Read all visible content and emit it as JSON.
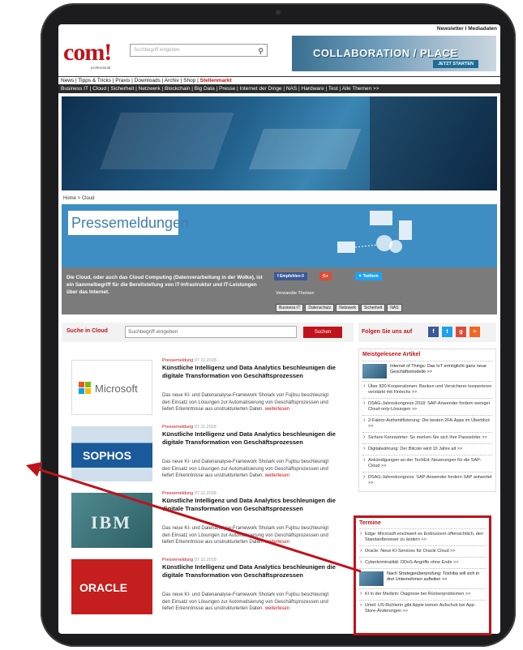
{
  "topbar": {
    "newsletter": "Newsletter",
    "separator": "I",
    "mediadaten": "Mediadaten"
  },
  "logo": {
    "text": "com!",
    "sub": "professional"
  },
  "header_search": {
    "placeholder": "Suchbegriff eingeben"
  },
  "banner": {
    "title": "COLLABORATION / PLACE",
    "button": "JETZT STARTEN"
  },
  "nav_primary": {
    "items": "News | Tipps & Tricks | Praxis | Downloads | Archiv | Shop |",
    "highlight": "Stellenmarkt"
  },
  "nav_secondary": "Business IT | Cloud | Sicherheit | Netzwerk | Blockchain | Big Data | Presse | Internet der Dinge | NAS | Hardware | Test | Alle Themen >>",
  "breadcrumb": "Home > Cloud",
  "press": {
    "title": "Pressemeldungen",
    "description": "Die Cloud, oder auch das Cloud Computing (Datenverarbeitung in der Wolke), ist ein Sammelbegriff für die Bereitstellung von IT-Infrastruktur und IT-Leistungen über das Internet.",
    "share_facebook": "Empfehlen 0",
    "share_gplus": "G+",
    "share_twitter": "Twittern",
    "related_label": "Verwandte Themen",
    "tags": [
      "Business-IT",
      "Datenschutz",
      "Netzwerk",
      "Sicherheit",
      "NAS"
    ]
  },
  "cloud_search": {
    "label": "Suche in Cloud",
    "placeholder": "Suchbegriff eingeben",
    "button": "Suchen"
  },
  "articles": [
    {
      "logo": "Microsoft",
      "category": "Pressemeldung",
      "date": "07.11.2018",
      "title": "Künstliche Intelligenz und Data Analytics beschleunigen die digitale Transformation von Geschäftsprozessen",
      "text": "Das neue KI- und Datenanalyse-Framework Sholark von Fujitsu beschleunigt den Einsatz von Lösungen zur Automatisierung von Geschäftsprozessen und liefert Erkenntnisse aus unstrukturierten Daten.",
      "more": "weiterlesen"
    },
    {
      "logo": "SOPHOS",
      "category": "Pressemeldung",
      "date": "07.11.2018",
      "title": "Künstliche Intelligenz und Data Analytics beschleunigen die digitale Transformation von Geschäftsprozessen",
      "text": "Das neue KI- und Datenanalyse-Framework Sholark von Fujitsu beschleunigt den Einsatz von Lösungen zur Automatisierung von Geschäftsprozessen und liefert Erkenntnisse aus unstrukturierten Daten.",
      "more": "weiterlesen"
    },
    {
      "logo": "IBM",
      "category": "Pressemeldung",
      "date": "07.11.2018",
      "title": "Künstliche Intelligenz und Data Analytics beschleunigen die digitale Transformation von Geschäftsprozessen",
      "text": "Das neue KI- und Datenanalyse-Framework Sholark von Fujitsu beschleunigt den Einsatz von Lösungen zur Automatisierung von Geschäftsprozessen und liefert Erkenntnisse aus unstrukturierten Daten.",
      "more": "weiterlesen"
    },
    {
      "logo": "ORACLE",
      "category": "Pressemeldung",
      "date": "07.11.2018",
      "title": "Künstliche Intelligenz und Data Analytics beschleunigen die digitale Transformation von Geschäftsprozessen",
      "text": "Das neue KI- und Datenanalyse-Framework Sholark von Fujitsu beschleunigt den Einsatz von Lösungen zur Automatisierung von Geschäftsprozessen und liefert Erkenntnisse aus unstrukturierten Daten.",
      "more": "weiterlesen"
    }
  ],
  "follow": {
    "label": "Folgen Sie uns auf"
  },
  "most_read": {
    "title": "Meistgelesene Artikel",
    "featured": "Internet of Things: Das IoT ermöglicht ganz neue Geschäftsmodelle >>",
    "items": [
      "Über 830 Kooperationen: Banken und Versicherer kooperieren verstärkt mit Fintechs >>",
      "DSAG-Jahreskongress 2018: SAP-Anwender fordern weniger Cloud-only-Lösungen >>",
      "2-Faktor-Authentifizierung: Die besten 2FA-Apps im Überblick >>",
      "Sichere Kennwörter: So merken Sie sich Ihre Passwörter >>",
      "Digitalwährung: Der Bitcoin wird 10 Jahre alt >>",
      "Ankündigungen an der TechEd: Neuerungen für die SAP-Cloud >>",
      "DSAG-Jahreskongress: SAP-Anwender fordern SAP antwortet >>"
    ]
  },
  "termine": {
    "title": "Termine",
    "items": [
      "Edge: Microsoft erschwert es Endnutzern offensichtlich, den Standardbrowser zu ändern >>",
      "Oracle: Neue KI-Services für Oracle Cloud >>",
      "Cyberkriminalität: DDoS-Angriffe ohne Ende >>"
    ],
    "featured": "Nach Strategieüberprüfung: Toshiba will sich in drei Unternehmen aufteilen >>",
    "items2": [
      "KI in der Medizin: Diagnose bei Rückenproblemen >>",
      "Urteil: US-Richterin gibt Apple keinen Aufschub bei App-Store-Änderungen >>"
    ]
  },
  "colors": {
    "accent": "#c0121a",
    "press_blue": "#3e8ec4",
    "nav_dark": "#2c2c2c"
  }
}
